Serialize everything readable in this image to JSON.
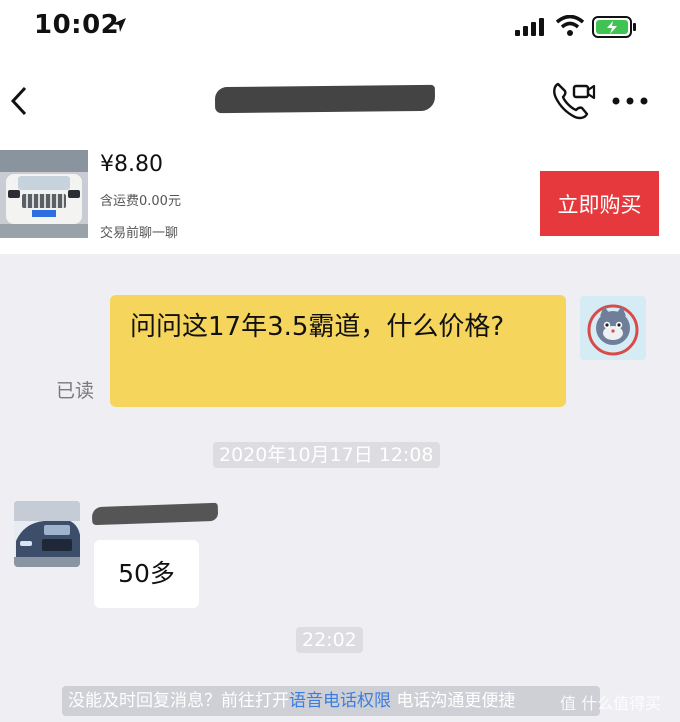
{
  "status_bar": {
    "time": "10:02"
  },
  "nav": {
    "back_icon": "chevron-left-icon",
    "call_icon": "phone-video-icon",
    "more_icon": "more-dots-icon"
  },
  "product": {
    "price": "¥8.80",
    "shipping": "含运费0.00元",
    "chat_hint": "交易前聊一聊",
    "buy_label": "立即购买",
    "buy_color": "#e5393e"
  },
  "messages": {
    "read_label": "已读",
    "outgoing_text": "问问这17年3.5霸道，什么价格?",
    "outgoing_color": "#f6d55c",
    "timestamp_1": "2020年10月17日 12:08",
    "incoming_text": "50多",
    "timestamp_2": "22:02"
  },
  "notice": {
    "prefix": "没能及时回复消息？前往打开",
    "link": "语音电话权限",
    "suffix": "电话沟通更便捷"
  },
  "watermark": "值 什么值得买"
}
